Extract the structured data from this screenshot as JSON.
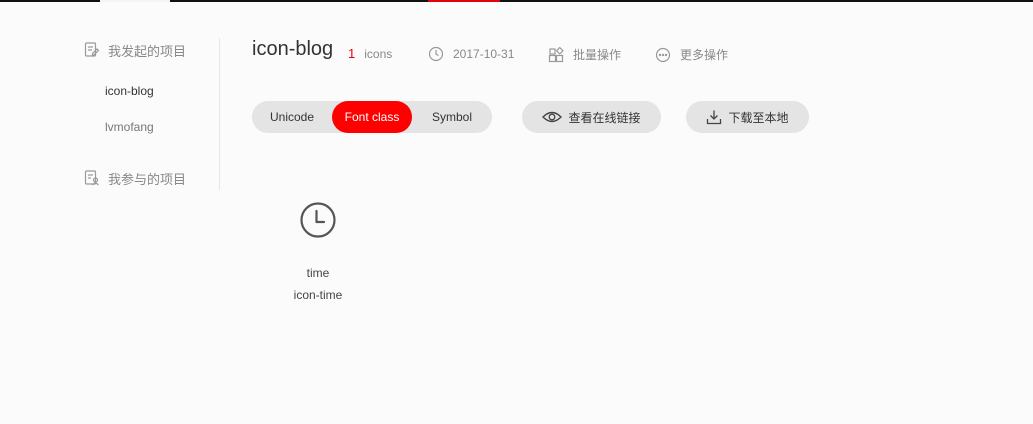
{
  "sidebar": {
    "my_projects": "我发起的项目",
    "projects": [
      "icon-blog",
      "lvmofang"
    ],
    "joined_projects": "我参与的项目"
  },
  "header": {
    "title": "icon-blog",
    "icon_count": "1",
    "icon_count_label": "icons",
    "date": "2017-10-31",
    "batch_action": "批量操作",
    "more_action": "更多操作"
  },
  "tabs": {
    "unicode": "Unicode",
    "font_class": "Font class",
    "symbol": "Symbol",
    "selected": "Font class"
  },
  "actions": {
    "view_online_link": "查看在线链接",
    "download_local": "下载至本地"
  },
  "icons": [
    {
      "name": "time",
      "code": "icon-time",
      "glyph": "clock-icon"
    }
  ],
  "colors": {
    "accent": "#ff0000",
    "count_red": "#e0000f",
    "pill_bg": "#e4e4e4",
    "page_bg": "#fbfbfb"
  }
}
